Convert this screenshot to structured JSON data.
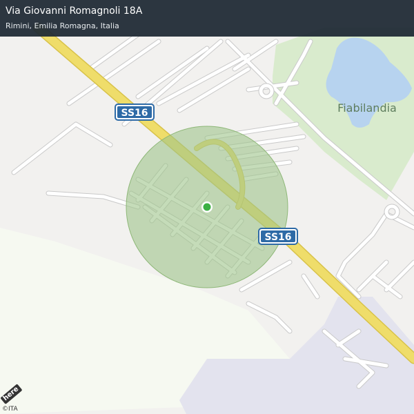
{
  "header": {
    "address_line": "Via Giovanni Romagnoli 18A",
    "locality_line": "Rimini, Emilia Romagna, Italia"
  },
  "map": {
    "road_shields": [
      "SS16",
      "SS16"
    ],
    "park_label": "Fiabilandia",
    "location_marker": "current-position",
    "accuracy_circle": "location-accuracy-area"
  },
  "footer": {
    "copyright": "©ITA",
    "provider_logo": "here"
  },
  "colors": {
    "land": "#f2f1ef",
    "road": "#ffffff",
    "road_outline": "#c9c9c9",
    "highway": "#efdd6a",
    "park": "#d9ebcd",
    "water": "#b7d3ef",
    "industrial": "#e3e3ee",
    "header_bg": "#212b36",
    "accuracy": "#9fc48a",
    "marker": "#3cb043",
    "shield": "#2d6aa6"
  }
}
